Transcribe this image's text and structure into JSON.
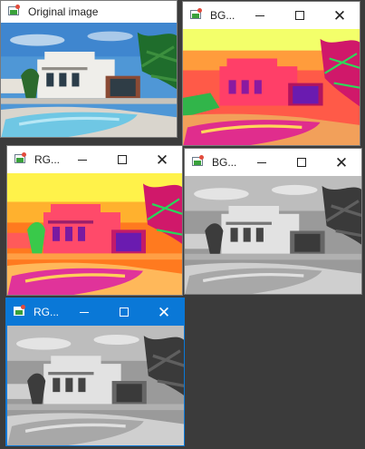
{
  "windows": [
    {
      "id": "original",
      "title": "Original image"
    },
    {
      "id": "bg1",
      "title": "BG...",
      "controls": [
        "minimize",
        "maximize",
        "close"
      ]
    },
    {
      "id": "rg1",
      "title": "RG...",
      "controls": [
        "minimize",
        "maximize",
        "close"
      ]
    },
    {
      "id": "bg2",
      "title": "BG...",
      "controls": [
        "minimize",
        "maximize",
        "close"
      ]
    },
    {
      "id": "rg2",
      "title": "RG...",
      "controls": [
        "minimize",
        "maximize",
        "close"
      ],
      "active": true
    }
  ],
  "colors": {
    "desktop": "#3b3b3b",
    "active_titlebar": "#0a78d7",
    "inactive_titlebar": "#ffffff"
  }
}
